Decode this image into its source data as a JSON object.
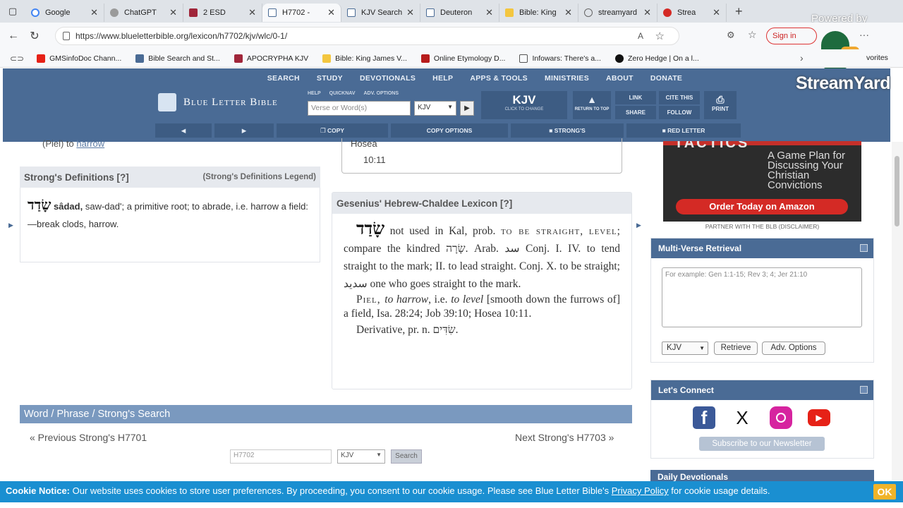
{
  "browser": {
    "tabs": [
      {
        "label": "Google",
        "color": "#ffffff"
      },
      {
        "label": "ChatGPT",
        "color": "#9a9a9a"
      },
      {
        "label": "2 ESD",
        "color": "#a0263a"
      },
      {
        "label": "H7702 - ",
        "color": "#4a6b95"
      },
      {
        "label": "KJV Search",
        "color": "#4a6b95"
      },
      {
        "label": "Deuteron",
        "color": "#4a6b95"
      },
      {
        "label": "Bible: King",
        "color": "#f3c63f"
      },
      {
        "label": "streamyard",
        "color": "#888888"
      },
      {
        "label": "Strea",
        "color": "#d42a25"
      }
    ],
    "new_tab": "+",
    "url": "https://www.blueletterbible.org/lexicon/h7702/kjv/wlc/0-1/",
    "sign_in": "Sign in",
    "favorites_label": "vorites",
    "bookmarks": [
      {
        "label": "GMSinfoDoc Chann...",
        "color": "#e62117"
      },
      {
        "label": "Bible Search and St...",
        "color": "#4a6b95"
      },
      {
        "label": "APOCRYPHA KJV",
        "color": "#a0263a"
      },
      {
        "label": "Bible: King James V...",
        "color": "#f3c63f"
      },
      {
        "label": "Online Etymology D...",
        "color": "#b71c1c"
      },
      {
        "label": "Infowars: There's a...",
        "color": "#555555"
      },
      {
        "label": "Zero Hedge | On a l...",
        "color": "#111111"
      }
    ]
  },
  "overlay": {
    "powered_by": "Powered by",
    "streamyard": "StreamYard"
  },
  "blb": {
    "nav": [
      "SEARCH",
      "STUDY",
      "DEVOTIONALS",
      "HELP",
      "APPS & TOOLS",
      "MINISTRIES",
      "ABOUT",
      "DONATE"
    ],
    "logo": "Blue Letter Bible",
    "mini_links": [
      "HELP",
      "QUICKNAV",
      "ADV. OPTIONS"
    ],
    "search_placeholder": "Verse or Word(s)",
    "version": "KJV",
    "version_big": "KJV",
    "click_to_change": "CLICK TO CHANGE",
    "return_to_top": "RETURN TO TOP",
    "link": "LINK",
    "share": "SHARE",
    "cite_this": "CITE THIS",
    "follow": "FOLLOW",
    "print": "PRINT",
    "copy": "COPY",
    "copy_options": "COPY OPTIONS",
    "strongs": "STRONG'S",
    "red_letter": "RED LETTER"
  },
  "top_fragment": {
    "prefix": "(Piel) to ",
    "link": "harrow",
    "hosea": "Hosea",
    "hosea_ref": "10:11"
  },
  "strongs_def": {
    "title": "Strong's Definitions [?]",
    "legend": "(Strong's Definitions Legend)",
    "hebrew": "שָׂדַד",
    "translit": "sâdad,",
    "pron": "saw-dad';",
    "def": " a primitive root; to abrade, i.e. harrow a field:—break clods, harrow."
  },
  "gesenius": {
    "title": "Gesenius' Hebrew-Chaldee Lexicon [?]",
    "heb": "שָׂדַד",
    "p1a": " not used in Kal, prob. ",
    "to": "to",
    "straight": " be straight,",
    "level": "level",
    "p1b": "; compare the kindred ",
    "heb2": "שָׂרָה",
    "p1c": ". Arab. ",
    "arab1": "سد",
    "p1d": " Conj. I. IV. to tend straight to the mark; II. to lead straight. Conj. X. to be straight; ",
    "arab2": "سديد",
    "p1e": " one who goes straight to the mark.",
    "p2a": "Piel, ",
    "p2b": "to harrow",
    "p2c": ", i.e. ",
    "p2d": "to level",
    "p2e": " [smooth down the furrows of] a field, Isa. 28:24; Job 39:10; Hosea 10:11.",
    "p3a": "Derivative, pr. n. ",
    "heb3": "שִׂדִּים",
    "p3b": "."
  },
  "wps": {
    "title": "Word / Phrase / Strong's Search",
    "prev": "« Previous Strong's H7701",
    "next": "Next Strong's H7703 »",
    "input_value": "H7702",
    "version": "KJV",
    "button": "Search"
  },
  "ad": {
    "brand": "TACTICS",
    "tagline": "A Game Plan for Discussing Your Christian Convictions",
    "cta": "Order Today on Amazon",
    "partner": "PARTNER WITH THE BLB (DISCLAIMER)"
  },
  "mvr": {
    "title": "Multi-Verse Retrieval",
    "placeholder": "For example: Gen 1:1-15; Rev 3; 4; Jer 21:10",
    "version": "KJV",
    "retrieve": "Retrieve",
    "adv": "Adv. Options"
  },
  "connect": {
    "title": "Let's Connect",
    "newsletter": "Subscribe to our Newsletter",
    "facebook": "f",
    "x": "X",
    "youtube": "▶"
  },
  "daily": {
    "title": "Daily Devotionals"
  },
  "cookie": {
    "label": "Cookie Notice:",
    "text": " Our website uses cookies to store user preferences. By proceeding, you consent to our cookie usage. Please see Blue Letter Bible's ",
    "policy": "Privacy Policy",
    "tail": " for cookie usage details.",
    "ok": "OK"
  }
}
